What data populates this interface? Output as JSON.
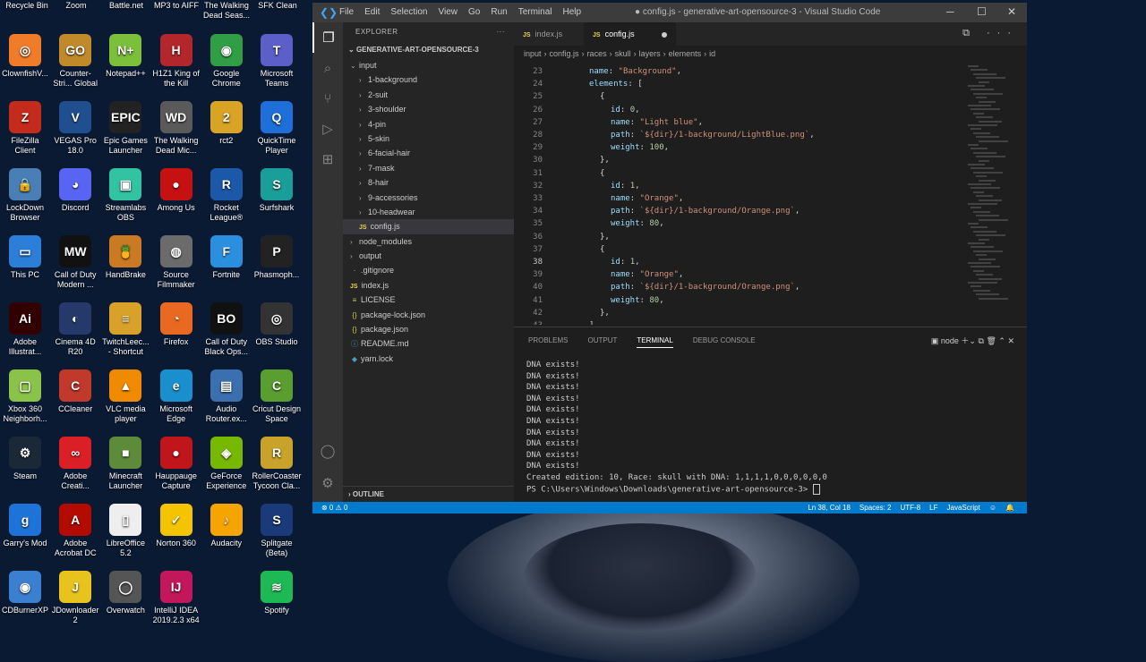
{
  "desktop": {
    "top_labels": [
      "Recycle Bin",
      "Zoom",
      "Battle.net",
      "MP3 to AIFF",
      "The Walking Dead Seas...",
      "SFK Clean"
    ],
    "icons": [
      {
        "label": "ClownfishV...",
        "icon": "clownfish-icon",
        "color": "#f07c2a",
        "glyph": "◎"
      },
      {
        "label": "Counter-Stri... Global Offe...",
        "icon": "csgo-icon",
        "color": "#c08a2a",
        "glyph": "GO"
      },
      {
        "label": "Notepad++",
        "icon": "notepadpp-icon",
        "color": "#7bbf3a",
        "glyph": "N+"
      },
      {
        "label": "H1Z1 King of the Kill",
        "icon": "h1z1-icon",
        "color": "#b3262b",
        "glyph": "H"
      },
      {
        "label": "Google Chrome",
        "icon": "chrome-icon",
        "color": "#2f9e44",
        "glyph": "◉"
      },
      {
        "label": "Microsoft Teams",
        "icon": "teams-icon",
        "color": "#5b5fc7",
        "glyph": "T"
      },
      {
        "label": "FileZilla Client",
        "icon": "filezilla-icon",
        "color": "#c42b1c",
        "glyph": "Z"
      },
      {
        "label": "VEGAS Pro 18.0",
        "icon": "vegas-icon",
        "color": "#1f4f8f",
        "glyph": "V"
      },
      {
        "label": "Epic Games Launcher",
        "icon": "epic-icon",
        "color": "#222222",
        "glyph": "EPIC"
      },
      {
        "label": "The Walking Dead Mic...",
        "icon": "walkingdead-icon",
        "color": "#5a5a5a",
        "glyph": "WD"
      },
      {
        "label": "rct2",
        "icon": "rct2-icon",
        "color": "#d9a324",
        "glyph": "2"
      },
      {
        "label": "QuickTime Player",
        "icon": "quicktime-icon",
        "color": "#1e6fd9",
        "glyph": "Q"
      },
      {
        "label": "LockDown Browser",
        "icon": "lockdown-icon",
        "color": "#4a7fb5",
        "glyph": "🔒"
      },
      {
        "label": "Discord",
        "icon": "discord-icon",
        "color": "#5865f2",
        "glyph": "◕"
      },
      {
        "label": "Streamlabs OBS",
        "icon": "streamlabs-icon",
        "color": "#31c3a2",
        "glyph": "▣"
      },
      {
        "label": "Among Us",
        "icon": "amongus-icon",
        "color": "#c51111",
        "glyph": "●"
      },
      {
        "label": "Rocket League®",
        "icon": "rocketleague-icon",
        "color": "#1c58a8",
        "glyph": "R"
      },
      {
        "label": "Surfshark",
        "icon": "surfshark-icon",
        "color": "#1a9e9a",
        "glyph": "S"
      },
      {
        "label": "This PC",
        "icon": "thispc-icon",
        "color": "#2b7fd8",
        "glyph": "▭"
      },
      {
        "label": "Call of Duty Modern ...",
        "icon": "codmw-icon",
        "color": "#111111",
        "glyph": "MW"
      },
      {
        "label": "HandBrake",
        "icon": "handbrake-icon",
        "color": "#c97a22",
        "glyph": "🍍"
      },
      {
        "label": "Source Filmmaker",
        "icon": "sfm-icon",
        "color": "#6b6b6b",
        "glyph": "◍"
      },
      {
        "label": "Fortnite",
        "icon": "fortnite-icon",
        "color": "#2b8fe0",
        "glyph": "F"
      },
      {
        "label": "Phasmoph...",
        "icon": "phasmophobia-icon",
        "color": "#222222",
        "glyph": "P"
      },
      {
        "label": "Adobe Illustrat...",
        "icon": "illustrator-icon",
        "color": "#330000",
        "glyph": "Ai"
      },
      {
        "label": "Cinema 4D R20",
        "icon": "cinema4d-icon",
        "color": "#253a6b",
        "glyph": "◐"
      },
      {
        "label": "TwitchLeec... - Shortcut",
        "icon": "twitchleecher-icon",
        "color": "#d8a12a",
        "glyph": "≡"
      },
      {
        "label": "Firefox",
        "icon": "firefox-icon",
        "color": "#e8691f",
        "glyph": "◔"
      },
      {
        "label": "Call of Duty Black Ops...",
        "icon": "codbo-icon",
        "color": "#111111",
        "glyph": "BO"
      },
      {
        "label": "OBS Studio",
        "icon": "obs-icon",
        "color": "#333333",
        "glyph": "◎"
      },
      {
        "label": "Xbox 360 Neighborh...",
        "icon": "xbox-icon",
        "color": "#8bc34a",
        "glyph": "▢"
      },
      {
        "label": "CCleaner",
        "icon": "ccleaner-icon",
        "color": "#c0392b",
        "glyph": "C"
      },
      {
        "label": "VLC media player",
        "icon": "vlc-icon",
        "color": "#f08a00",
        "glyph": "▲"
      },
      {
        "label": "Microsoft Edge",
        "icon": "edge-icon",
        "color": "#1a8fce",
        "glyph": "e"
      },
      {
        "label": "Audio Router.ex...",
        "icon": "audiorouter-icon",
        "color": "#3a6fb0",
        "glyph": "▤"
      },
      {
        "label": "Cricut Design Space",
        "icon": "cricut-icon",
        "color": "#5a9e2f",
        "glyph": "C"
      },
      {
        "label": "Steam",
        "icon": "steam-icon",
        "color": "#1b2838",
        "glyph": "⚙"
      },
      {
        "label": "Adobe Creati...",
        "icon": "creativecloud-icon",
        "color": "#da1f26",
        "glyph": "∞"
      },
      {
        "label": "Minecraft Launcher",
        "icon": "minecraft-icon",
        "color": "#5d8b3a",
        "glyph": "■"
      },
      {
        "label": "Hauppauge Capture",
        "icon": "hauppauge-icon",
        "color": "#c0151b",
        "glyph": "●"
      },
      {
        "label": "GeForce Experience",
        "icon": "geforce-icon",
        "color": "#76b900",
        "glyph": "◈"
      },
      {
        "label": "RollerCoaster Tycoon Cla...",
        "icon": "rct-classic-icon",
        "color": "#c9a22a",
        "glyph": "R"
      },
      {
        "label": "Garry's Mod",
        "icon": "garrysmod-icon",
        "color": "#1e73d8",
        "glyph": "g"
      },
      {
        "label": "Adobe Acrobat DC",
        "icon": "acrobat-icon",
        "color": "#b30b00",
        "glyph": "A"
      },
      {
        "label": "LibreOffice 5.2",
        "icon": "libreoffice-icon",
        "color": "#eeeeee",
        "glyph": "▯"
      },
      {
        "label": "Norton 360",
        "icon": "norton-icon",
        "color": "#f5c400",
        "glyph": "✓"
      },
      {
        "label": "Audacity",
        "icon": "audacity-icon",
        "color": "#f5a400",
        "glyph": "♪"
      },
      {
        "label": "Splitgate (Beta)",
        "icon": "splitgate-icon",
        "color": "#1b3a7a",
        "glyph": "S"
      },
      {
        "label": "CDBurnerXP",
        "icon": "cdburnerxp-icon",
        "color": "#3b7fd0",
        "glyph": "◉"
      },
      {
        "label": "JDownloader 2",
        "icon": "jdownloader-icon",
        "color": "#e8c31e",
        "glyph": "J"
      },
      {
        "label": "Overwatch",
        "icon": "overwatch-icon",
        "color": "#555555",
        "glyph": "◯"
      },
      {
        "label": "IntelliJ IDEA 2019.2.3 x64",
        "icon": "intellij-icon",
        "color": "#c2185b",
        "glyph": "IJ"
      },
      {
        "label": "",
        "icon": "empty-slot",
        "color": "transparent",
        "glyph": ""
      },
      {
        "label": "Spotify",
        "icon": "spotify-icon",
        "color": "#1db954",
        "glyph": "≋"
      }
    ]
  },
  "vscode": {
    "menu": [
      "File",
      "Edit",
      "Selection",
      "View",
      "Go",
      "Run",
      "Terminal",
      "Help"
    ],
    "window_title": "● config.js - generative-art-opensource-3 - Visual Studio Code",
    "explorer": {
      "header": "EXPLORER",
      "project": "GENERATIVE-ART-OPENSOURCE-3",
      "tree": [
        {
          "label": "input",
          "kind": "folder-open",
          "depth": 0
        },
        {
          "label": "1-background",
          "kind": "folder",
          "depth": 1
        },
        {
          "label": "2-suit",
          "kind": "folder",
          "depth": 1
        },
        {
          "label": "3-shoulder",
          "kind": "folder",
          "depth": 1
        },
        {
          "label": "4-pin",
          "kind": "folder",
          "depth": 1
        },
        {
          "label": "5-skin",
          "kind": "folder",
          "depth": 1
        },
        {
          "label": "6-facial-hair",
          "kind": "folder",
          "depth": 1
        },
        {
          "label": "7-mask",
          "kind": "folder",
          "depth": 1
        },
        {
          "label": "8-hair",
          "kind": "folder",
          "depth": 1
        },
        {
          "label": "9-accessories",
          "kind": "folder",
          "depth": 1
        },
        {
          "label": "10-headwear",
          "kind": "folder",
          "depth": 1
        },
        {
          "label": "config.js",
          "kind": "js",
          "depth": 1,
          "selected": true
        },
        {
          "label": "node_modules",
          "kind": "folder",
          "depth": 0
        },
        {
          "label": "output",
          "kind": "folder",
          "depth": 0
        },
        {
          "label": ".gitignore",
          "kind": "gitignore",
          "depth": 0
        },
        {
          "label": "index.js",
          "kind": "js",
          "depth": 0
        },
        {
          "label": "LICENSE",
          "kind": "license",
          "depth": 0
        },
        {
          "label": "package-lock.json",
          "kind": "json",
          "depth": 0
        },
        {
          "label": "package.json",
          "kind": "json",
          "depth": 0
        },
        {
          "label": "README.md",
          "kind": "md",
          "depth": 0
        },
        {
          "label": "yarn.lock",
          "kind": "yarn",
          "depth": 0
        }
      ],
      "outline": "OUTLINE"
    },
    "tabs": [
      {
        "label": "index.js",
        "active": false
      },
      {
        "label": "config.js",
        "active": true,
        "modified": true
      }
    ],
    "breadcrumbs": [
      "input",
      "config.js",
      "races",
      "skull",
      "layers",
      "elements",
      "id"
    ],
    "editor_lines": [
      {
        "n": "23",
        "code": "name: \"Background\",",
        "indent": 0
      },
      {
        "n": "24",
        "code": "elements: [",
        "indent": 0
      },
      {
        "n": "25",
        "code": "{",
        "indent": 1
      },
      {
        "n": "26",
        "code": "id: 0,",
        "indent": 2
      },
      {
        "n": "27",
        "code": "name: \"Light blue\",",
        "indent": 2
      },
      {
        "n": "28",
        "code": "path: `${dir}/1-background/LightBlue.png`,",
        "indent": 2
      },
      {
        "n": "29",
        "code": "weight: 100,",
        "indent": 2
      },
      {
        "n": "30",
        "code": "},",
        "indent": 1
      },
      {
        "n": "31",
        "code": "{",
        "indent": 1
      },
      {
        "n": "32",
        "code": "id: 1,",
        "indent": 2
      },
      {
        "n": "33",
        "code": "name: \"Orange\",",
        "indent": 2
      },
      {
        "n": "34",
        "code": "path: `${dir}/1-background/Orange.png`,",
        "indent": 2
      },
      {
        "n": "35",
        "code": "weight: 80,",
        "indent": 2
      },
      {
        "n": "36",
        "code": "},",
        "indent": 1
      },
      {
        "n": "37",
        "code": "{",
        "indent": 1
      },
      {
        "n": "38",
        "code": "id: 1,",
        "indent": 2,
        "current": true
      },
      {
        "n": "39",
        "code": "name: \"Orange\",",
        "indent": 2
      },
      {
        "n": "40",
        "code": "path: `${dir}/1-background/Orange.png`,",
        "indent": 2
      },
      {
        "n": "41",
        "code": "weight: 80,",
        "indent": 2
      },
      {
        "n": "42",
        "code": "},",
        "indent": 1
      },
      {
        "n": "43",
        "code": "],",
        "indent": 0
      }
    ],
    "panel": {
      "tabs": [
        "PROBLEMS",
        "OUTPUT",
        "TERMINAL",
        "DEBUG CONSOLE"
      ],
      "active_tab": "TERMINAL",
      "shell": "node",
      "terminal_lines": [
        "DNA exists!",
        "DNA exists!",
        "DNA exists!",
        "DNA exists!",
        "DNA exists!",
        "DNA exists!",
        "DNA exists!",
        "DNA exists!",
        "DNA exists!",
        "DNA exists!",
        "Created edition: 10, Race: skull with DNA: 1,1,1,1,0,0,0,0,0,0"
      ],
      "prompt": "PS C:\\Users\\Windows\\Downloads\\generative-art-opensource-3> "
    },
    "status": {
      "errors": "⊗ 0 ⚠ 0",
      "position": "Ln 38, Col 18",
      "spaces": "Spaces: 2",
      "encoding": "UTF-8",
      "eol": "LF",
      "language": "JavaScript"
    }
  }
}
